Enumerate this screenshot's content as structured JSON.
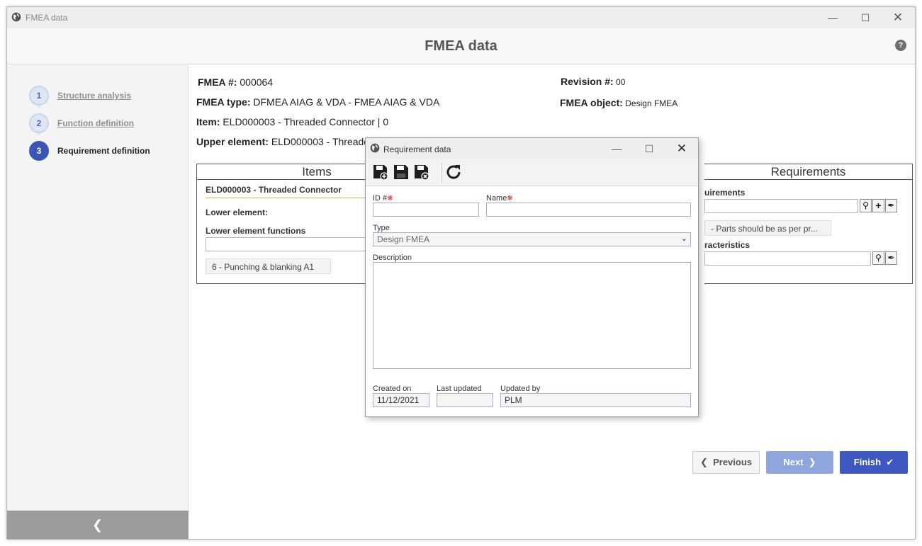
{
  "window": {
    "title": "FMEA data"
  },
  "header": {
    "title": "FMEA data",
    "help": "?"
  },
  "steps": [
    {
      "num": "1",
      "label": "Structure analysis"
    },
    {
      "num": "2",
      "label": "Function definition"
    },
    {
      "num": "3",
      "label": "Requirement definition"
    }
  ],
  "info": {
    "fmea_num_label": "FMEA #:",
    "fmea_num": "000064",
    "revision_label": "Revision #:",
    "revision": "00",
    "type_label": "FMEA type:",
    "type": "DFMEA AIAG & VDA - FMEA AIAG & VDA",
    "object_label": "FMEA object:",
    "object": "Design FMEA",
    "item_label": "Item:",
    "item": "ELD000003 - Threaded Connector | 0",
    "upper_label": "Upper element:",
    "upper": "ELD000003 - Threade"
  },
  "items_panel": {
    "title": "Items",
    "element": "ELD000003 - Threaded Connector",
    "lower_element_label": "Lower element:",
    "lower_functions_label": "Lower element functions",
    "chip": "6 - Punching & blanking A1"
  },
  "req_panel": {
    "title": "Requirements",
    "requirements_label": "uirements",
    "chip": "- Parts should be as per pr...",
    "characteristics_label": "racteristics"
  },
  "footer": {
    "previous": "Previous",
    "next": "Next",
    "finish": "Finish"
  },
  "dialog": {
    "title": "Requirement data",
    "id_label": "ID #",
    "name_label": "Name",
    "type_label": "Type",
    "type_value": "Design FMEA",
    "description_label": "Description",
    "created_label": "Created on",
    "created_value": "11/12/2021",
    "updated_label": "Last updated",
    "updated_value": "",
    "updated_by_label": "Updated by",
    "updated_by_value": "PLM"
  }
}
